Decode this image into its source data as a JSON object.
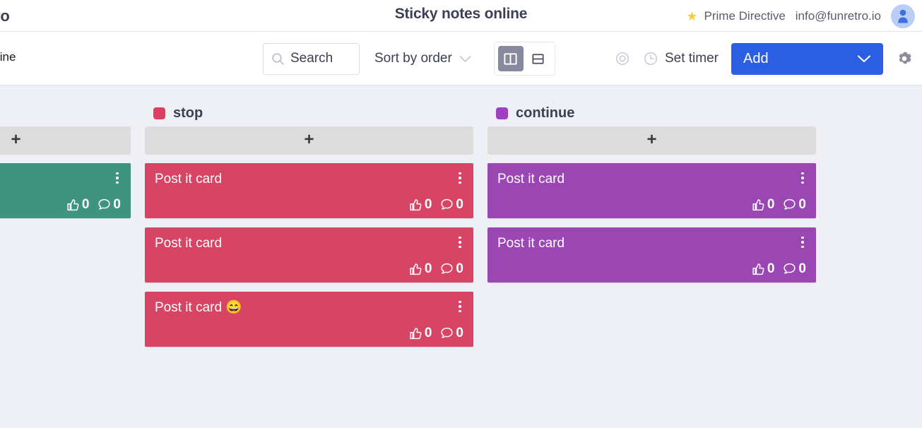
{
  "topbar": {
    "brand_truncated": "ro",
    "app_title": "Sticky notes online",
    "prime_directive_label": "Prime Directive",
    "star_icon": "star-icon",
    "user_email": "info@funretro.io",
    "avatar_icon": "user-avatar-icon",
    "avatar_bg": "#b9cdf7",
    "avatar_fg": "#3b6fe0"
  },
  "toolbar": {
    "board_name_truncated": "line",
    "search": {
      "icon": "search-icon",
      "label": "Search",
      "placeholder": "Search"
    },
    "sort": {
      "label": "Sort by order",
      "chevron_icon": "chevron-down-icon"
    },
    "view_toggle": {
      "columns_icon": "columns-view-icon",
      "rows_icon": "rows-view-icon",
      "active": "columns",
      "active_bg": "#878a9e"
    },
    "visibility_icon": "eye-visibility-icon",
    "timer": {
      "icon": "clock-icon",
      "label": "Set timer"
    },
    "add": {
      "label": "Add",
      "chevron_icon": "chevron-down-icon",
      "color": "#2b5fe3"
    },
    "settings_icon": "gear-icon"
  },
  "board": {
    "background": "#eff0f5",
    "add_card_label": "+",
    "columns": [
      {
        "title": "",
        "color": "#3f9480",
        "clipped": true,
        "cards": [
          {
            "text": "",
            "likes": "0",
            "comments": "0",
            "color": "#3f9480"
          }
        ]
      },
      {
        "title": "stop",
        "color": "#de3e63",
        "clipped": false,
        "cards": [
          {
            "text": "Post it card",
            "likes": "0",
            "comments": "0",
            "color": "#d74464"
          },
          {
            "text": "Post it card",
            "likes": "0",
            "comments": "0",
            "color": "#d74464"
          },
          {
            "text": "Post it card 😄",
            "likes": "0",
            "comments": "0",
            "color": "#d74464"
          }
        ]
      },
      {
        "title": "continue",
        "color": "#a13fc4",
        "clipped": false,
        "cards": [
          {
            "text": "Post it card",
            "likes": "0",
            "comments": "0",
            "color": "#9a47b4"
          },
          {
            "text": "Post it card",
            "likes": "0",
            "comments": "0",
            "color": "#9a47b4"
          }
        ]
      }
    ]
  }
}
